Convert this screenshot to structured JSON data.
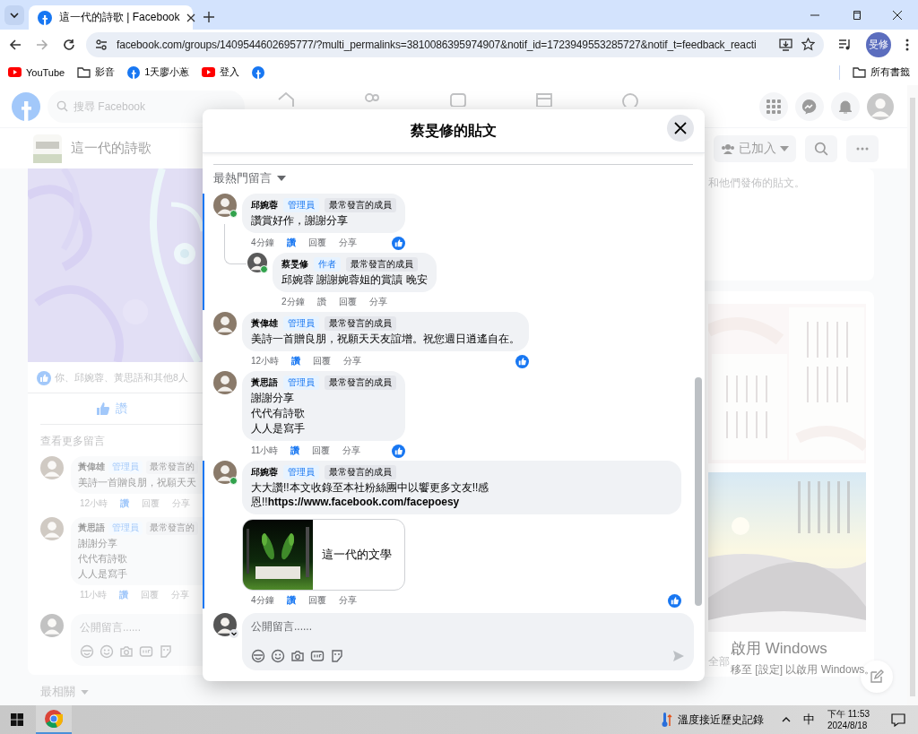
{
  "browser": {
    "tab_title": "這一代的詩歌 | Facebook",
    "url": "facebook.com/groups/1409544602695777/?multi_permalinks=3810086395974907&notif_id=1723949553285727&notif_t=feedback_reacti",
    "profile": "旻修",
    "bookmarks": [
      {
        "kind": "youtube",
        "label": "YouTube"
      },
      {
        "kind": "folder",
        "label": "影音"
      },
      {
        "kind": "facebook",
        "label": "1天廖小蔥"
      },
      {
        "kind": "youtube",
        "label": "登入"
      },
      {
        "kind": "facebook"
      }
    ],
    "all_bookmarks": "所有書籤"
  },
  "facebook": {
    "search": {
      "placeholder": "搜尋 Facebook"
    },
    "group": {
      "name": "這一代的詩歌",
      "joined": "已加入"
    },
    "post": {
      "reactions": "你、邱婉蓉、黃思語和其他8人",
      "like": "讚",
      "more_comments": "查看更多留言",
      "comments": [
        {
          "author": "黃偉雄",
          "role": "管理員",
          "badge": "最常發言的",
          "lines": [
            "美詩一首贈良朋，祝願天天"
          ],
          "time": "12小時",
          "like": "讚",
          "liked": true,
          "reply": "回覆",
          "share": "分享"
        },
        {
          "author": "黃思語",
          "role": "管理員",
          "badge": "最常發言的",
          "lines": [
            "謝謝分享",
            "代代有詩歌",
            "人人是寫手"
          ],
          "time": "11小時",
          "like": "讚",
          "liked": true,
          "reply": "回覆",
          "share": "分享"
        }
      ],
      "composer": {
        "placeholder": "公開留言......"
      },
      "sort": "最相關"
    },
    "sidebar": {
      "note": "和他們發佈的貼文。",
      "all": "全部"
    }
  },
  "modal": {
    "title": "蔡旻修的貼文",
    "sort": "最熱門留言",
    "comments": [
      {
        "author": "邱婉蓉",
        "online": true,
        "highlighted": true,
        "role": "管理員",
        "badge": "最常發言的成員",
        "lines": [
          "讚賞好作，謝謝分享"
        ],
        "time": "4分鐘",
        "like": "讚",
        "liked": true,
        "reply": "回覆",
        "share": "分享",
        "reaction": true,
        "children": [
          {
            "author": "蔡旻修",
            "online": true,
            "highlighted": false,
            "role": "作者",
            "badge": "最常發言的成員",
            "lines": [
              "邱婉蓉 謝謝婉蓉姐的賞讀 晚安"
            ],
            "time": "2分鐘",
            "like": "讚",
            "liked": false,
            "reply": "回覆",
            "share": "分享",
            "reaction": false
          }
        ]
      },
      {
        "author": "黃偉雄",
        "online": false,
        "highlighted": false,
        "role": "管理員",
        "badge": "最常發言的成員",
        "lines": [
          "美詩一首贈良朋，祝願天天友誼增。祝您週日逍遙自在。"
        ],
        "time": "12小時",
        "like": "讚",
        "liked": true,
        "reply": "回覆",
        "share": "分享",
        "reaction": true
      },
      {
        "author": "黃思語",
        "online": false,
        "highlighted": false,
        "role": "管理員",
        "badge": "最常發言的成員",
        "lines": [
          "謝謝分享",
          "代代有詩歌",
          "人人是寫手"
        ],
        "time": "11小時",
        "like": "讚",
        "liked": true,
        "reply": "回覆",
        "share": "分享",
        "reaction": true
      },
      {
        "author": "邱婉蓉",
        "online": true,
        "highlighted": true,
        "role": "管理員",
        "badge": "最常發言的成員",
        "lines": [
          "大大讚!!本文收錄至本社粉絲團中以饗更多文友!!感恩!!**https://www.facebook.com/facepoesy**"
        ],
        "preview": {
          "title": "這一代的文學"
        },
        "time": "4分鐘",
        "like": "讚",
        "liked": true,
        "reply": "回覆",
        "share": "分享",
        "reaction": true
      }
    ],
    "composer": {
      "placeholder": "公開留言......"
    }
  },
  "windows": {
    "title": "啟用 Windows",
    "text": "移至 [設定] 以啟用 Windows。"
  },
  "taskbar": {
    "weather": "溫度接近歷史記錄",
    "ime": "中",
    "time": "下午 11:53",
    "date": "2024/8/18"
  }
}
